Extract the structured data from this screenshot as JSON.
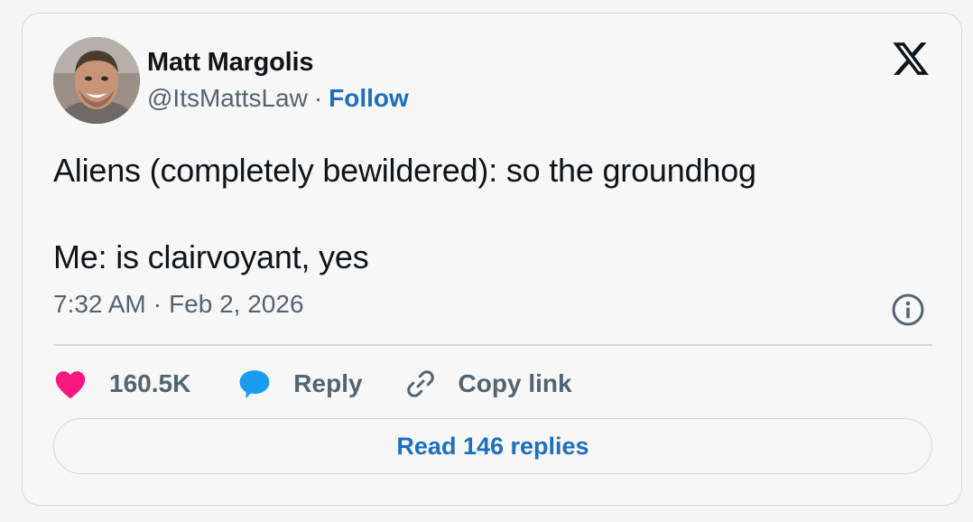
{
  "author": {
    "display_name": "Matt Margolis",
    "handle": "@ItsMattsLaw",
    "separator": "·",
    "follow_label": "Follow"
  },
  "tweet": {
    "line1": "Aliens (completely bewildered): so the groundhog",
    "line2": "Me: is clairvoyant, yes",
    "time": "7:32 AM",
    "separator": "·",
    "date": "Feb 2, 2026"
  },
  "actions": {
    "likes_count": "160.5K",
    "reply_label": "Reply",
    "copy_link_label": "Copy link"
  },
  "replies_button_label": "Read 146 replies",
  "icons": {
    "brand": "x-logo-icon",
    "info": "info-icon",
    "like": "heart-icon",
    "reply": "speech-bubble-icon",
    "link": "link-icon"
  },
  "colors": {
    "heart": "#f91880",
    "reply_bubble": "#1d9bf0",
    "follow_link": "#1d6fbf",
    "secondary_text": "#536471",
    "border": "#cfd9de"
  }
}
